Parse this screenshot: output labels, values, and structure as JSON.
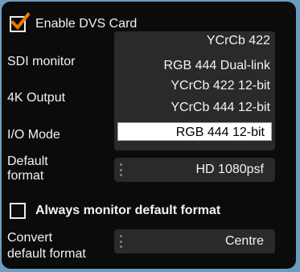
{
  "enable_dvs": {
    "label": "Enable DVS Card",
    "checked": true,
    "accent": "#f07800"
  },
  "labels": {
    "sdi_monitor": "SDI monitor",
    "output_4k": "4K Output",
    "io_mode": "I/O Mode",
    "default_format_1": "Default",
    "default_format_2": "format",
    "convert_1": "Convert",
    "convert_2": "default format"
  },
  "io_mode_options": [
    "YCrCb 422",
    "RGB 444 Dual-link",
    "YCrCb 422 12-bit",
    "YCrCb 444 12-bit",
    "RGB 444 12-bit"
  ],
  "io_mode_selected": "RGB 444 12-bit",
  "default_format": {
    "value": "HD 1080psf"
  },
  "always_monitor": {
    "label": "Always monitor default format",
    "checked": false
  },
  "convert_default_format": {
    "value": "Centre"
  },
  "colors": {
    "background": "#6a9ec0",
    "panel": "#0b0b0b",
    "control": "#2a2a2a"
  }
}
